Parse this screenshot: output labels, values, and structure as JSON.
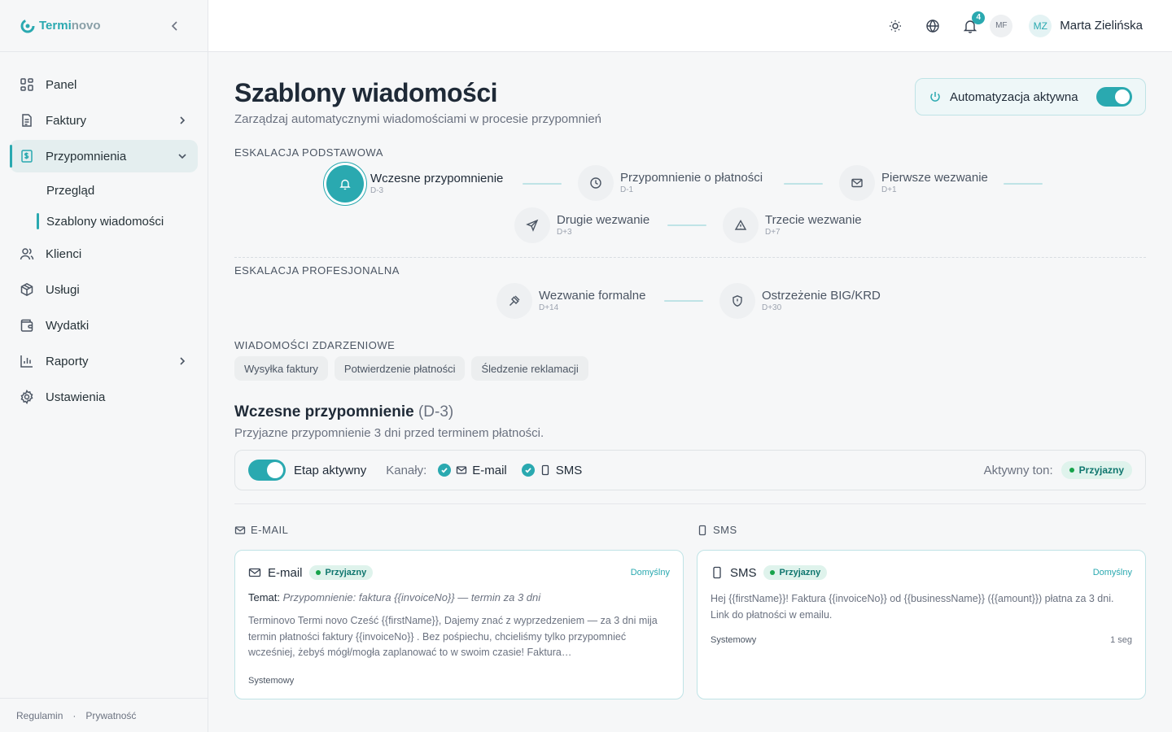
{
  "brand": {
    "name_part1": "Termi",
    "name_part2": "novo",
    "accent": "#2aa9b0"
  },
  "sidebar": {
    "items": [
      {
        "label": "Panel",
        "icon": "dashboard-icon"
      },
      {
        "label": "Faktury",
        "icon": "document-icon"
      },
      {
        "label": "Przypomnienia",
        "icon": "dollar-file-icon"
      },
      {
        "label": "Klienci",
        "icon": "users-icon"
      },
      {
        "label": "Usługi",
        "icon": "box-icon"
      },
      {
        "label": "Wydatki",
        "icon": "wallet-icon"
      },
      {
        "label": "Raporty",
        "icon": "bar-chart-icon"
      },
      {
        "label": "Ustawienia",
        "icon": "gear-icon"
      }
    ],
    "sub_items": [
      {
        "label": "Przegląd"
      },
      {
        "label": "Szablony wiadomości"
      }
    ],
    "footer": {
      "terms": "Regulamin",
      "sep": "·",
      "privacy": "Prywatność"
    }
  },
  "topbar": {
    "notifications_count": "4",
    "initials_small": "MF",
    "user_initials": "MZ",
    "user_name": "Marta Zielińska"
  },
  "header": {
    "title": "Szablony wiadomości",
    "subtitle": "Zarządzaj automatycznymi wiadomościami w procesie przypomnień",
    "automation_label": "Automatyzacja aktywna"
  },
  "sections": {
    "basic": "ESKALACJA PODSTAWOWA",
    "professional": "ESKALACJA PROFESJONALNA",
    "events": "WIADOMOŚCI ZDARZENIOWE"
  },
  "steps_basic": [
    {
      "name": "Wczesne przypomnienie",
      "offset": "D-3",
      "icon": "bell-icon"
    },
    {
      "name": "Przypomnienie o płatności",
      "offset": "D-1",
      "icon": "clock-icon"
    },
    {
      "name": "Pierwsze wezwanie",
      "offset": "D+1",
      "icon": "mail-icon"
    },
    {
      "name": "Drugie wezwanie",
      "offset": "D+3",
      "icon": "send-icon"
    },
    {
      "name": "Trzecie wezwanie",
      "offset": "D+7",
      "icon": "warning-icon"
    }
  ],
  "steps_pro": [
    {
      "name": "Wezwanie formalne",
      "offset": "D+14",
      "icon": "gavel-icon"
    },
    {
      "name": "Ostrzeżenie BIG/KRD",
      "offset": "D+30",
      "icon": "shield-icon"
    }
  ],
  "event_chips": [
    "Wysyłka faktury",
    "Potwierdzenie płatności",
    "Śledzenie reklamacji"
  ],
  "detail": {
    "title": "Wczesne przypomnienie",
    "code": "(D-3)",
    "subtitle": "Przyjazne przypomnienie 3 dni przed terminem płatności.",
    "stage_active": "Etap aktywny",
    "channels_label": "Kanały:",
    "channel_email": "E-mail",
    "channel_sms": "SMS",
    "tone_label": "Aktywny ton:",
    "tone_value": "Przyjazny"
  },
  "columns": {
    "email": "E-MAIL",
    "sms": "SMS"
  },
  "email_card": {
    "title": "E-mail",
    "tone": "Przyjazny",
    "default": "Domyślny",
    "subject_label": "Temat:",
    "subject": "Przypomnienie: faktura {{invoiceNo}} — termin za 3 dni",
    "body": "Terminovo Termi novo Cześć {{firstName}}, Dajemy znać z wyprzedzeniem — za 3 dni mija termin płatności faktury {{invoiceNo}} . Bez pośpiechu, chcieliśmy tylko przypomnieć wcześniej, żebyś mógł/mogła zaplanować to w swoim czasie! Faktura…",
    "footer_left": "Systemowy"
  },
  "sms_card": {
    "title": "SMS",
    "tone": "Przyjazny",
    "default": "Domyślny",
    "body": "Hej {{firstName}}! Faktura {{invoiceNo}} od {{businessName}} ({{amount}}) płatna za 3 dni. Link do płatności w emailu.",
    "footer_left": "Systemowy",
    "footer_right": "1 seg"
  }
}
